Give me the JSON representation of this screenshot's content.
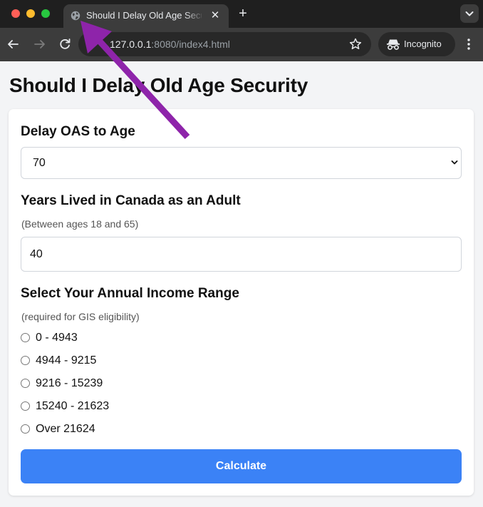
{
  "browser": {
    "tab_title": "Should I Delay Old Age Security",
    "url_host": "127.0.0.1",
    "url_path": ":8080/index4.html",
    "incognito_label": "Incognito",
    "tab_close_glyph": "✕",
    "new_tab_glyph": "+"
  },
  "page": {
    "title": "Should I Delay Old Age Security"
  },
  "form": {
    "delay_label": "Delay OAS to Age",
    "delay_value": "70",
    "years_label": "Years Lived in Canada as an Adult",
    "years_hint": "(Between ages 18 and 65)",
    "years_value": "40",
    "income_label": "Select Your Annual Income Range",
    "income_hint": "(required for GIS eligibility)",
    "income_options": [
      "0 - 4943",
      "4944 - 9215",
      "9216 - 15239",
      "15240 - 21623",
      "Over 21624"
    ],
    "calculate_label": "Calculate"
  },
  "colors": {
    "accent": "#3b82f6",
    "annotation_arrow": "#8e24aa"
  },
  "icons": [
    "globe-icon",
    "close-icon",
    "plus-icon",
    "chevron-down-icon",
    "back-arrow-icon",
    "forward-arrow-icon",
    "reload-icon",
    "star-icon",
    "incognito-icon",
    "more-vert-icon"
  ]
}
